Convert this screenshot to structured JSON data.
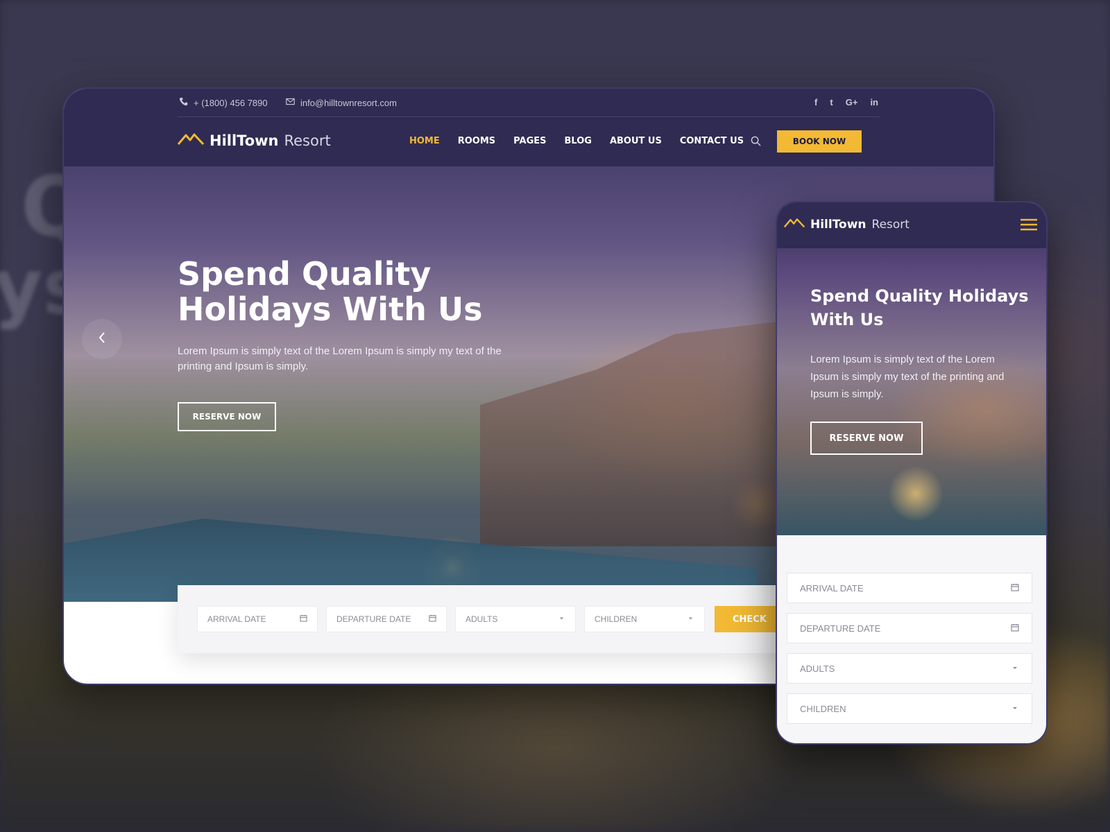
{
  "contact": {
    "phone": "+ (1800) 456 7890",
    "email": "info@hilltownresort.com"
  },
  "socials": [
    "f",
    "t",
    "G+",
    "in"
  ],
  "brand": {
    "name_strong": "HillTown",
    "name_light": "Resort"
  },
  "nav": {
    "items": [
      {
        "label": "HOME",
        "active": true
      },
      {
        "label": "ROOMS"
      },
      {
        "label": "PAGES"
      },
      {
        "label": "BLOG"
      },
      {
        "label": "ABOUT US"
      },
      {
        "label": "CONTACT US"
      }
    ],
    "book_label": "BOOK NOW"
  },
  "hero": {
    "title_line1": "Spend Quality",
    "title_line2": "Holidays With Us",
    "text": "Lorem Ipsum is simply text of the Lorem Ipsum is simply my text of the printing and Ipsum is simply.",
    "reserve_label": "RESERVE NOW"
  },
  "booking": {
    "arrival_placeholder": "ARRIVAL DATE",
    "departure_placeholder": "DEPARTURE DATE",
    "adults_placeholder": "ADULTS",
    "children_placeholder": "CHILDREN",
    "check_label": "CHECK"
  },
  "mobile": {
    "title": "Spend Quality Holidays With Us",
    "text": "Lorem Ipsum is simply text of the Lorem Ipsum is simply my text of the printing and Ipsum is simply.",
    "reserve_label": "RESERVE NOW"
  },
  "colors": {
    "accent": "#f2b934",
    "header_bg": "#2f2b52"
  },
  "icons": [
    "phone-icon",
    "email-icon",
    "facebook-icon",
    "twitter-icon",
    "google-plus-icon",
    "linkedin-icon",
    "search-icon",
    "calendar-icon",
    "caret-down-icon",
    "chevron-left-icon",
    "hamburger-icon",
    "mountain-logo-icon"
  ]
}
